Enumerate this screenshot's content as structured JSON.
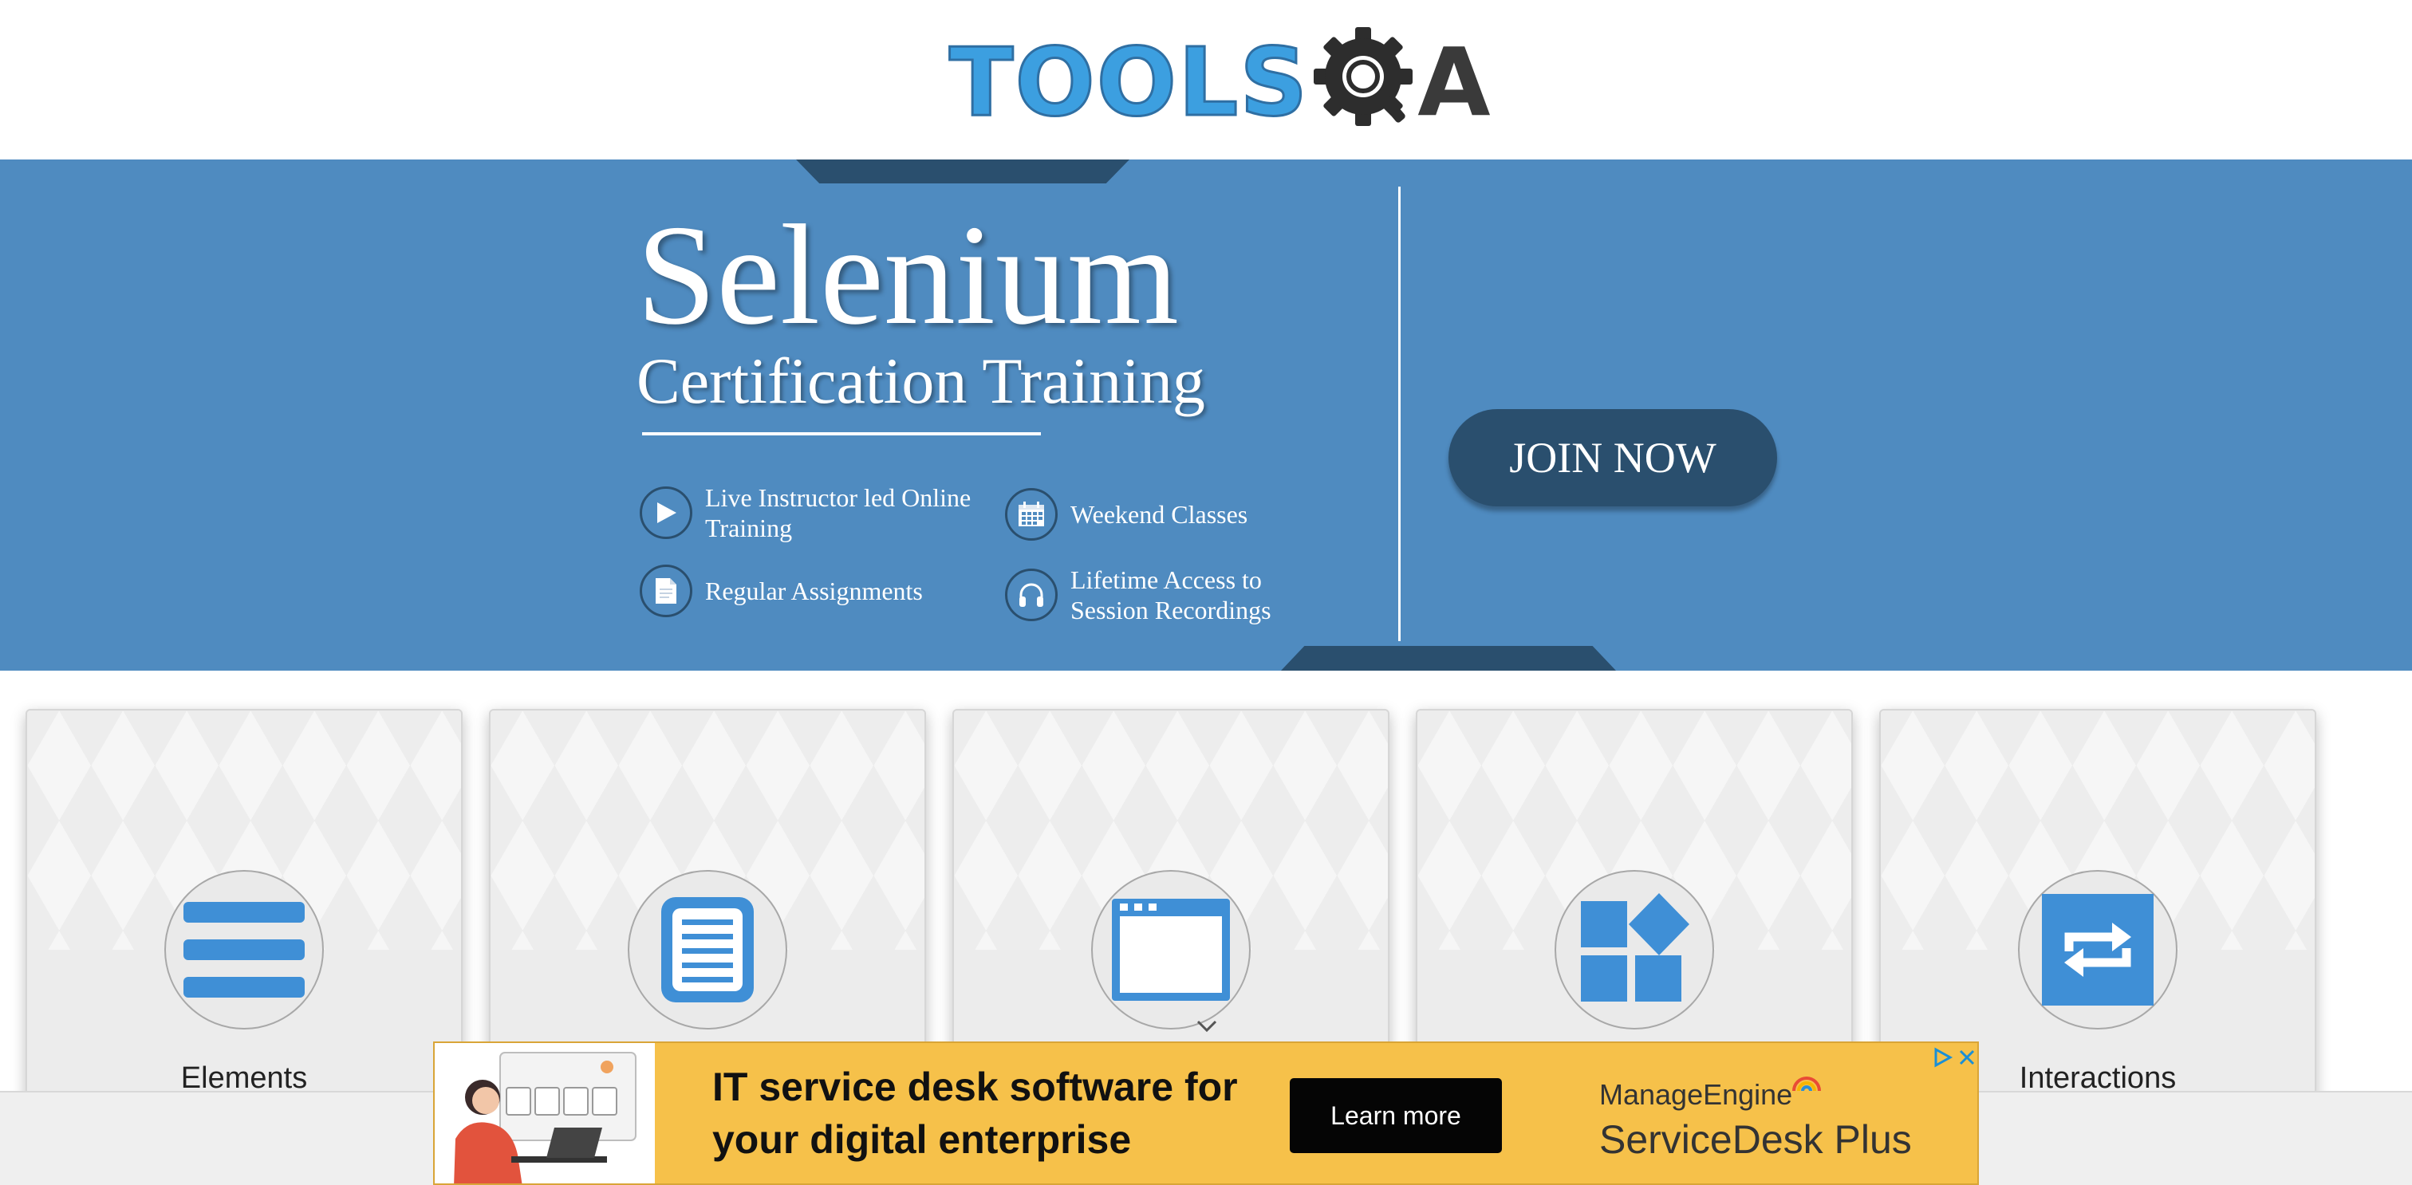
{
  "header": {
    "logo_text_tools": "TOOLS",
    "logo_text_a": "A",
    "logo_icon": "gear-magnifier-icon"
  },
  "banner": {
    "title": "Selenium",
    "subtitle": "Certification Training",
    "features": [
      {
        "label": "Live Instructor led Online Training",
        "icon": "play-icon"
      },
      {
        "label": "Weekend Classes",
        "icon": "calendar-icon"
      },
      {
        "label": "Regular Assignments",
        "icon": "document-icon"
      },
      {
        "label": "Lifetime Access to Session Recordings",
        "icon": "headphones-icon"
      }
    ],
    "join_button": "JOIN NOW",
    "colors": {
      "background": "#4f8bc0",
      "dark": "#2a4f6e"
    }
  },
  "cards": [
    {
      "title": "Elements",
      "icon": "hamburger-menu-icon"
    },
    {
      "title": "",
      "icon": "form-document-icon"
    },
    {
      "title": "",
      "icon": "browser-window-icon"
    },
    {
      "title": "",
      "icon": "widgets-icon"
    },
    {
      "title": "Interactions",
      "icon": "repeat-arrows-icon"
    }
  ],
  "ad": {
    "headline": "IT service desk software for your digital enterprise",
    "button": "Learn more",
    "brand_small": "ManageEngine",
    "brand_big": "ServiceDesk Plus",
    "background": "#f6c14a"
  },
  "colors": {
    "accent": "#3c9fe0"
  }
}
